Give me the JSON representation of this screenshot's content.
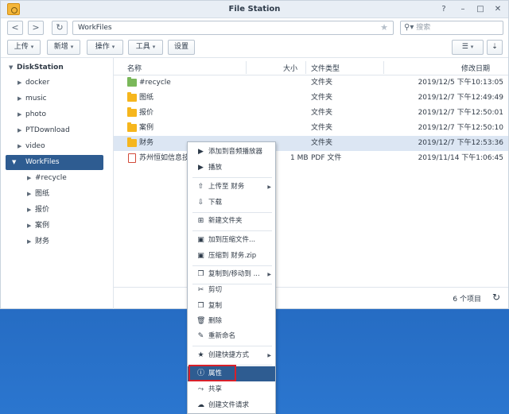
{
  "window": {
    "title": "File Station",
    "help": "?",
    "minimize": "–",
    "maximize": "□",
    "close": "✕"
  },
  "address": {
    "back": "<",
    "forward": ">",
    "refresh": "↻",
    "path": "WorkFiles",
    "search_placeholder": "搜索"
  },
  "toolbar": {
    "upload": "上传",
    "new": "新增",
    "action": "操作",
    "tools": "工具",
    "settings": "设置"
  },
  "sidebar": {
    "root": "DiskStation",
    "items": [
      "docker",
      "music",
      "photo",
      "PTDownload",
      "video",
      "WorkFiles"
    ],
    "children": [
      "#recycle",
      "图纸",
      "报价",
      "案例",
      "财务"
    ]
  },
  "list": {
    "columns": {
      "name": "名称",
      "size": "大小",
      "type": "文件类型",
      "modified": "修改日期"
    },
    "rows": [
      {
        "name": "#recycle",
        "size": "",
        "type": "文件夹",
        "modified": "2019/12/5 下午10:13:05"
      },
      {
        "name": "图纸",
        "size": "",
        "type": "文件夹",
        "modified": "2019/12/7 下午12:49:49"
      },
      {
        "name": "报价",
        "size": "",
        "type": "文件夹",
        "modified": "2019/12/7 下午12:50:01"
      },
      {
        "name": "案例",
        "size": "",
        "type": "文件夹",
        "modified": "2019/12/7 下午12:50:10"
      },
      {
        "name": "财务",
        "size": "",
        "type": "文件夹",
        "modified": "2019/12/7 下午12:53:36"
      },
      {
        "name": "苏州恒如信息技术",
        "size": "1 MB",
        "type": "PDF 文件",
        "modified": "2019/11/14 下午1:06:45"
      }
    ],
    "count": "6 个项目"
  },
  "context_menu": {
    "items": [
      "添加到音频播放器",
      "播放",
      "上传至 财务",
      "下载",
      "新建文件夹",
      "加到压缩文件...",
      "压缩到 财务.zip",
      "复制到/移动到 ...",
      "剪切",
      "复制",
      "删除",
      "重新命名",
      "创建快捷方式",
      "属性",
      "共享",
      "创建文件请求"
    ]
  }
}
